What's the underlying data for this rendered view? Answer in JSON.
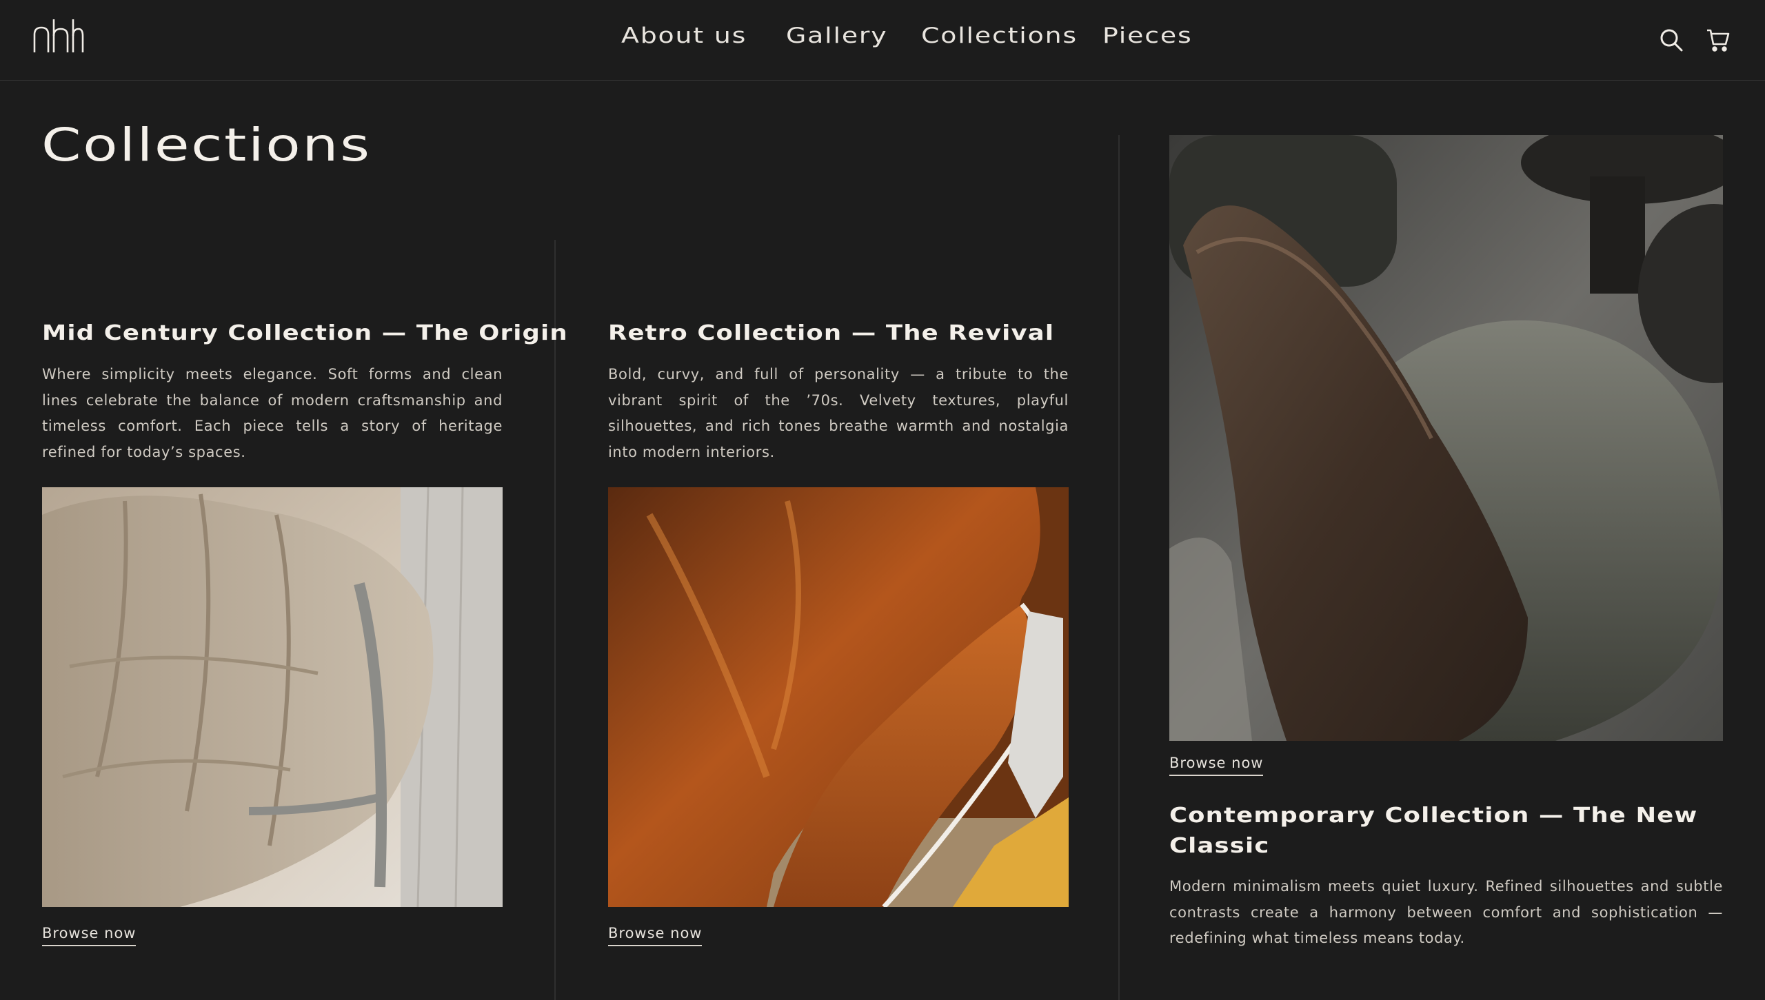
{
  "header": {
    "logo_text": "nh",
    "nav": [
      {
        "label": "About us"
      },
      {
        "label": "Gallery"
      },
      {
        "label": "Collections"
      },
      {
        "label": "Pieces"
      }
    ],
    "icons": [
      "search-icon",
      "cart-icon"
    ]
  },
  "page": {
    "title": "Collections"
  },
  "collections": [
    {
      "title": "Mid Century Collection — The Origin",
      "description": "Where simplicity meets elegance. Soft forms and clean lines celebrate the balance of modern craftsmanship and timeless comfort. Each piece tells a story of heritage refined for today’s spaces.",
      "browse_label": "Browse now",
      "image": "beige-quilted-armchair-photo"
    },
    {
      "title": "Retro Collection — The Revival",
      "description": "Bold, curvy, and full of personality — a tribute to the vibrant spirit of the ’70s. Velvety textures, playful silhouettes, and rich tones breathe warmth and nostalgia into modern interiors.",
      "browse_label": "Browse now",
      "image": "rust-velvet-chair-photo"
    },
    {
      "title": "Contemporary Collection — The New Classic",
      "description": "Modern minimalism meets quiet luxury. Refined silhouettes and subtle contrasts create a harmony between comfort and sophistication — redefining what timeless means today.",
      "browse_label": "Browse now",
      "image": "leather-boucle-chair-photo"
    }
  ],
  "colors": {
    "background": "#1c1c1c",
    "text": "#f0ece6",
    "muted_text": "#cfcac2",
    "divider": "#2f2f2f"
  }
}
